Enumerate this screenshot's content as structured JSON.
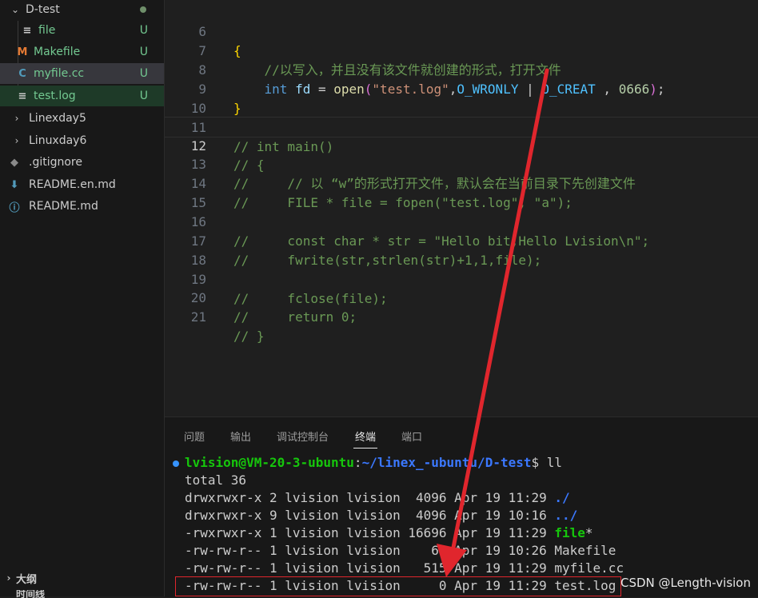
{
  "sidebar": {
    "folder": {
      "label": "D-test"
    },
    "files": [
      {
        "label": "file",
        "icon": "≡",
        "badge": "U"
      },
      {
        "label": "Makefile",
        "icon": "M",
        "badge": "U"
      },
      {
        "label": "myfile.cc",
        "icon": "C",
        "badge": "U"
      },
      {
        "label": "test.log",
        "icon": "≡",
        "badge": "U"
      }
    ],
    "folders": [
      {
        "label": "Linexday5"
      },
      {
        "label": "Linuxday6"
      }
    ],
    "others": [
      {
        "label": ".gitignore"
      },
      {
        "label": "README.en.md"
      },
      {
        "label": "README.md"
      }
    ],
    "outline": {
      "label": "大纲"
    },
    "timeline": {
      "label": "时间线"
    }
  },
  "editor": {
    "lines": [
      {
        "n": "6",
        "text": "{"
      },
      {
        "n": "7",
        "text": "    //以写入，并且没有该文件就创建的形式，打开文件"
      },
      {
        "n": "8",
        "kw": "int",
        "var": "fd",
        "fn": "open",
        "str": "\"test.log\"",
        "m1": "O_WRONLY",
        "m2": "O_CREAT",
        "num": "0666"
      },
      {
        "n": "9",
        "text": "}"
      },
      {
        "n": "10",
        "text": ""
      },
      {
        "n": "11",
        "text": "// int main()"
      },
      {
        "n": "12",
        "text": "// {"
      },
      {
        "n": "13",
        "text": "//     // 以 “w”的形式打开文件，默认会在当前目录下先创建文件"
      },
      {
        "n": "14",
        "text": "//     FILE * file = fopen(\"test.log\", \"a\");"
      },
      {
        "n": "15",
        "text": ""
      },
      {
        "n": "16",
        "text": "//     const char * str = \"Hello bit,Hello Lvision\\n\";"
      },
      {
        "n": "17",
        "text": "//     fwrite(str,strlen(str)+1,1,file);"
      },
      {
        "n": "18",
        "text": ""
      },
      {
        "n": "19",
        "text": "//     fclose(file);"
      },
      {
        "n": "20",
        "text": "//     return 0;"
      },
      {
        "n": "21",
        "text": "// }"
      }
    ]
  },
  "panel": {
    "tabs": [
      "问题",
      "输出",
      "调试控制台",
      "终端",
      "端口"
    ],
    "active_tab": "终端"
  },
  "terminal": {
    "prompt_user": "lvision@VM-20-3-ubuntu",
    "prompt_sep": ":",
    "prompt_path": "~/linex_-ubuntu/D-test",
    "prompt_end": "$ ",
    "command": "ll",
    "total": "total 36",
    "rows": [
      {
        "meta": "drwxrwxr-x 2 lvision lvision  4096 Apr 19 11:29 ",
        "name": "./"
      },
      {
        "meta": "drwxrwxr-x 9 lvision lvision  4096 Apr 19 10:16 ",
        "name": "../"
      },
      {
        "meta": "-rwxrwxr-x 1 lvision lvision 16696 Apr 19 11:29 ",
        "name": "file",
        "suffix": "*"
      },
      {
        "meta": "-rw-rw-r-- 1 lvision lvision    62 Apr 19 10:26 ",
        "name": "Makefile"
      },
      {
        "meta": "-rw-rw-r-- 1 lvision lvision   515 Apr 19 11:29 ",
        "name": "myfile.cc"
      },
      {
        "meta": "-rw-rw-r-- 1 lvision lvision     0 Apr 19 11:29 ",
        "name": "test.log"
      }
    ]
  },
  "watermark": "CSDN @Length-vision",
  "colors": {
    "annotation": "#e0262d",
    "git_untracked": "#73c991",
    "prompt_user": "#16c60c",
    "prompt_path": "#3b78ff"
  }
}
